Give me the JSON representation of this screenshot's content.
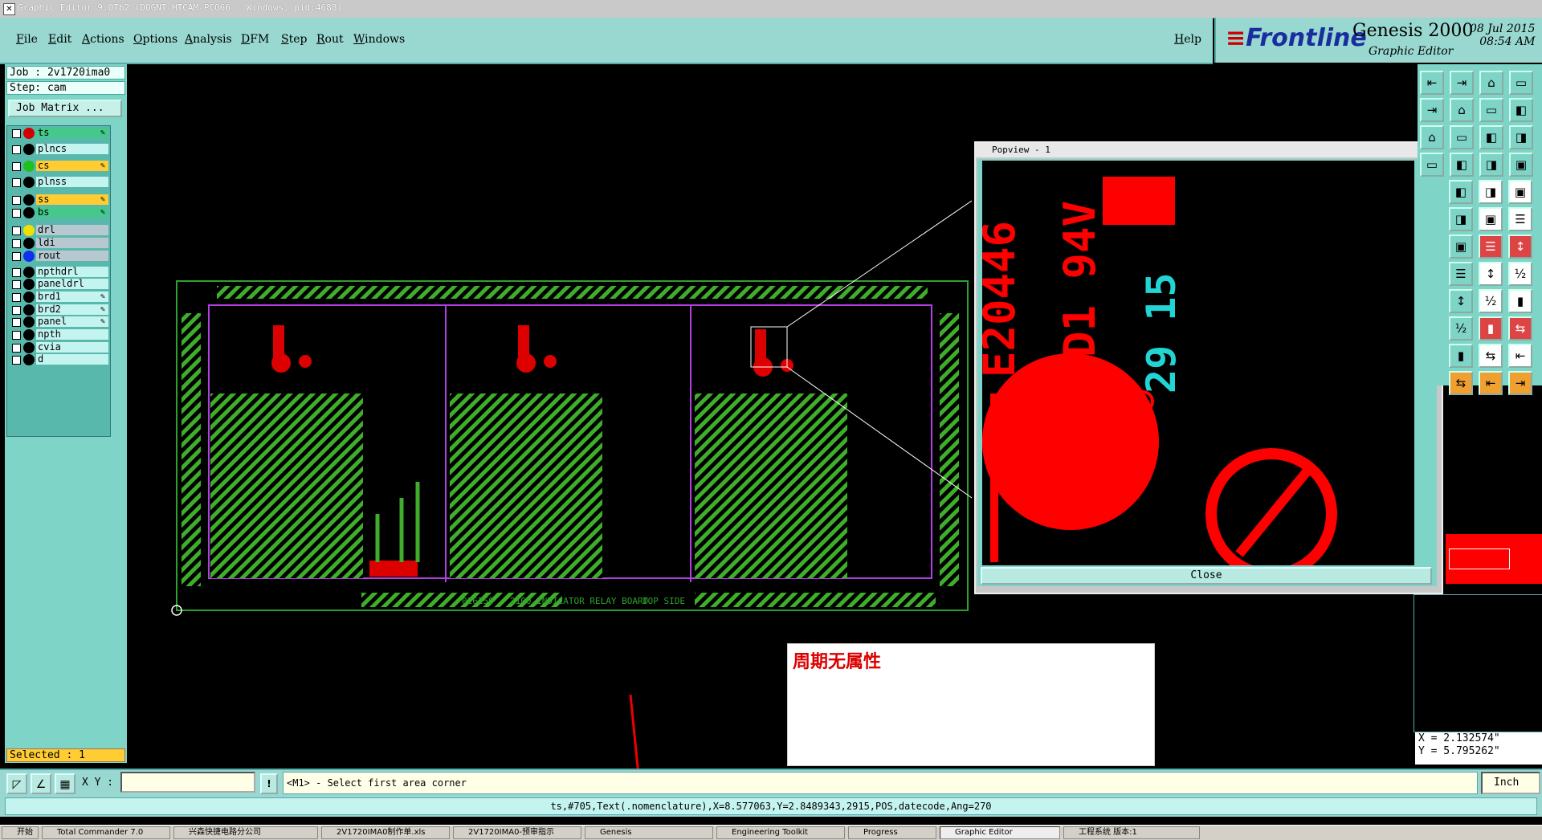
{
  "window": {
    "title": "Graphic Editor 9.0Tb2 (DOGNT-HTCAM-PC066 - Windows, pid:4688)"
  },
  "menu": [
    "File",
    "Edit",
    "Actions",
    "Options",
    "Analysis",
    "DFM",
    "Step",
    "Rout",
    "Windows"
  ],
  "help_label": "Help",
  "brand": {
    "logo": "Frontline",
    "product": "Genesis 2000",
    "subtitle": "Graphic Editor",
    "date": "08 Jul 2015",
    "time": "08:54 AM"
  },
  "job": {
    "job_label": "Job  : 2v1720ima0",
    "step_label": "Step: cam",
    "matrix_button": "Job Matrix ..."
  },
  "layers": [
    {
      "name": "ts",
      "swatch": "#d00000",
      "bg": "#46c88c",
      "affected": true
    },
    {
      "name": "plncs",
      "swatch": "#000",
      "bg": "#c4f4f0"
    },
    {
      "name": "cs",
      "swatch": "#20c020",
      "bg": "#ffcc33",
      "affected": true
    },
    {
      "name": "plnss",
      "swatch": "#000",
      "bg": "#c4f4f0"
    },
    {
      "name": "ss",
      "swatch": "#000",
      "bg": "#ffcc33",
      "affected": true
    },
    {
      "name": "bs",
      "swatch": "#000",
      "bg": "#46c88c",
      "affected": true
    },
    {
      "name": "drl",
      "swatch": "#f0e000",
      "bg": "#b8c8d0"
    },
    {
      "name": "ldi",
      "swatch": "#000",
      "bg": "#b8c8d0"
    },
    {
      "name": "rout",
      "swatch": "#1030f0",
      "bg": "#b8c8d0"
    },
    {
      "name": "npthdrl",
      "swatch": "#000",
      "bg": "#c4f4f0"
    },
    {
      "name": "paneldrl",
      "swatch": "#000",
      "bg": "#c4f4f0"
    },
    {
      "name": "brd1",
      "swatch": "#000",
      "bg": "#c4f4f0",
      "affected": true
    },
    {
      "name": "brd2",
      "swatch": "#000",
      "bg": "#c4f4f0",
      "affected": true
    },
    {
      "name": "panel",
      "swatch": "#000",
      "bg": "#c4f4f0",
      "affected": true
    },
    {
      "name": "npth",
      "swatch": "#000",
      "bg": "#c4f4f0"
    },
    {
      "name": "cvia",
      "swatch": "#000",
      "bg": "#c4f4f0"
    },
    {
      "name": "d",
      "swatch": "#000",
      "bg": "#c4f4f0"
    }
  ],
  "selected_label": "Selected : 1",
  "board_text": {
    "code": "026250",
    "desc": "2100 INDICATOR RELAY BOARD",
    "side": "TOP SIDE"
  },
  "popview": {
    "title": "Popview - 1",
    "close_label": "Close",
    "text_e": "E20446",
    "text_d": "D1 94V",
    "text_date": "29 15"
  },
  "annotation": "周期无属性",
  "coords": {
    "x": "X = 2.132574\"",
    "y": "Y = 5.795262\""
  },
  "cmd": {
    "xy_label": "X Y :",
    "xy_value": "",
    "prompt": "<M1> - Select first area corner",
    "units": "Inch"
  },
  "status": "ts,#705,Text(.nomenclature),X=8.577063,Y=2.8489343,2915,POS,datecode,Ang=270",
  "taskbar": [
    {
      "label": "开始"
    },
    {
      "label": "Total Commander 7.0"
    },
    {
      "label": "兴森快捷电路分公司"
    },
    {
      "label": "2V1720IMA0制作单.xls"
    },
    {
      "label": "2V1720IMA0-预审指示"
    },
    {
      "label": "Genesis"
    },
    {
      "label": "Engineering Toolkit"
    },
    {
      "label": "Progress"
    },
    {
      "label": "Graphic Editor",
      "active": true
    },
    {
      "label": "工程系统 版本:1"
    }
  ],
  "toolbar_icons": [
    "zoom-home-icon",
    "zoom-in-icon",
    "zoom-fit-icon",
    "redraw-icon",
    "pan-icon",
    "measure-icon",
    "snap-icon",
    "grid-icon",
    "select-icon",
    "add-icon",
    "delete-icon",
    "move-icon"
  ]
}
